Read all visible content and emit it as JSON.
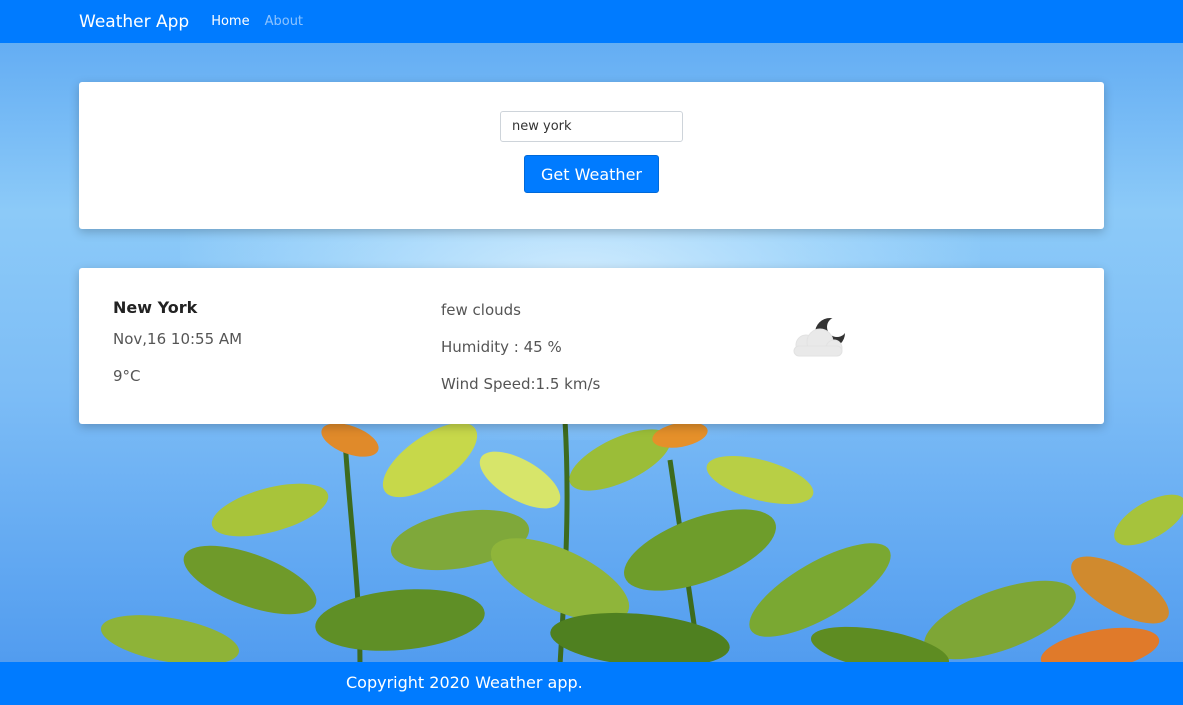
{
  "navbar": {
    "brand": "Weather App",
    "links": [
      {
        "label": "Home",
        "active": true
      },
      {
        "label": "About",
        "active": false
      }
    ]
  },
  "search": {
    "value": "new york",
    "button_label": "Get Weather"
  },
  "weather": {
    "city": "New York",
    "datetime": "Nov,16 10:55 AM",
    "temperature": "9°C",
    "description": "few clouds",
    "humidity": "Humidity : 45 %",
    "wind": "Wind Speed:1.5 km/s",
    "icon": "cloud-moon-icon"
  },
  "footer": {
    "copyright": "Copyright 2020 Weather app."
  },
  "colors": {
    "primary": "#007bff",
    "card": "#ffffff"
  }
}
